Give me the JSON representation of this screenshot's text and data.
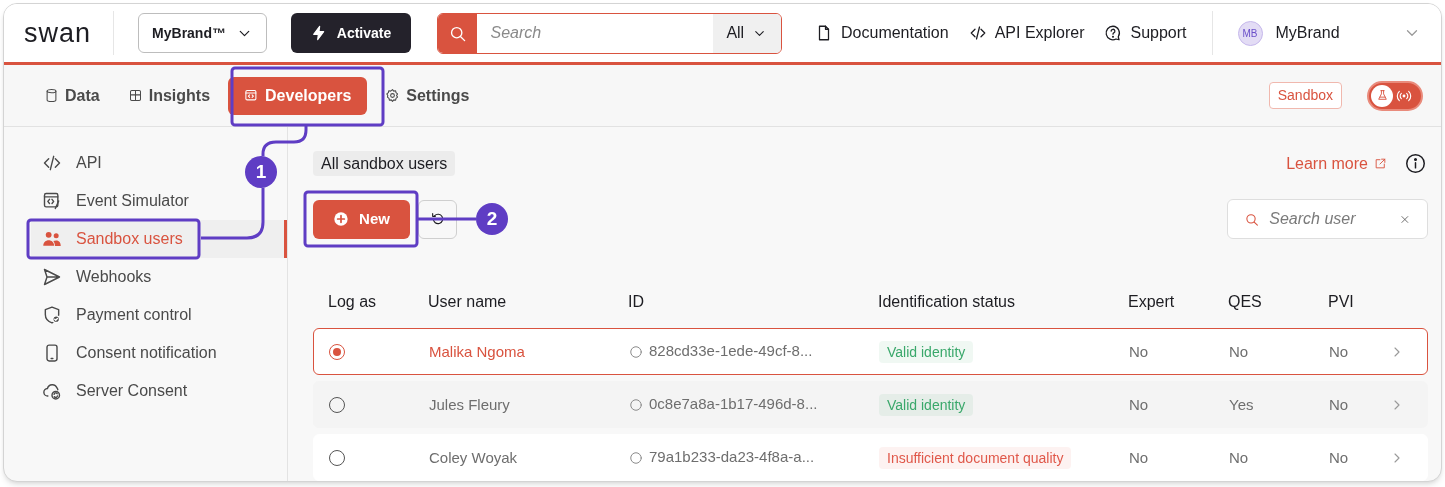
{
  "header": {
    "logo": "swan",
    "brand_select": "MyBrand™",
    "activate_button": "Activate",
    "search": {
      "placeholder": "Search",
      "scope": "All"
    },
    "links": [
      "Documentation",
      "API Explorer",
      "Support"
    ],
    "account": {
      "initials": "MB",
      "name": "MyBrand"
    }
  },
  "tabs": [
    {
      "label": "Data",
      "selected": false
    },
    {
      "label": "Insights",
      "selected": false
    },
    {
      "label": "Developers",
      "selected": true
    },
    {
      "label": "Settings",
      "selected": false
    }
  ],
  "environment_badge": "Sandbox",
  "live_mode_toggle": {
    "on": false
  },
  "sidebar": {
    "items": [
      {
        "label": "API",
        "selected": false
      },
      {
        "label": "Event Simulator",
        "selected": false
      },
      {
        "label": "Sandbox users",
        "selected": true
      },
      {
        "label": "Webhooks",
        "selected": false
      },
      {
        "label": "Payment control",
        "selected": false
      },
      {
        "label": "Consent notification",
        "selected": false
      },
      {
        "label": "Server Consent",
        "selected": false
      }
    ]
  },
  "content": {
    "filter_chip": "All sandbox users",
    "learn_more": "Learn more",
    "new_button": "New",
    "search": {
      "placeholder": "Search user"
    }
  },
  "table": {
    "columns": [
      "Log as",
      "User name",
      "ID",
      "Identification status",
      "Expert",
      "QES",
      "PVI"
    ],
    "rows": [
      {
        "selected": true,
        "user_name": "Malika Ngoma",
        "id": "828cd33e-1ede-49cf-8...",
        "status": {
          "text": "Valid identity",
          "color": "#3aa86b"
        },
        "expert": "No",
        "qes": "No",
        "pvi": "No"
      },
      {
        "selected": false,
        "user_name": "Jules Fleury",
        "id": "0c8e7a8a-1b17-496d-8...",
        "status": {
          "text": "Valid identity",
          "color": "#3aa86b"
        },
        "expert": "No",
        "qes": "Yes",
        "pvi": "No"
      },
      {
        "selected": false,
        "user_name": "Coley Woyak",
        "id": "79a1b233-da23-4f8a-a...",
        "status": {
          "text": "Insufficient document quality",
          "color": "#e0584a"
        },
        "expert": "No",
        "qes": "No",
        "pvi": "No"
      }
    ]
  },
  "annotations": [
    "1",
    "2"
  ]
}
